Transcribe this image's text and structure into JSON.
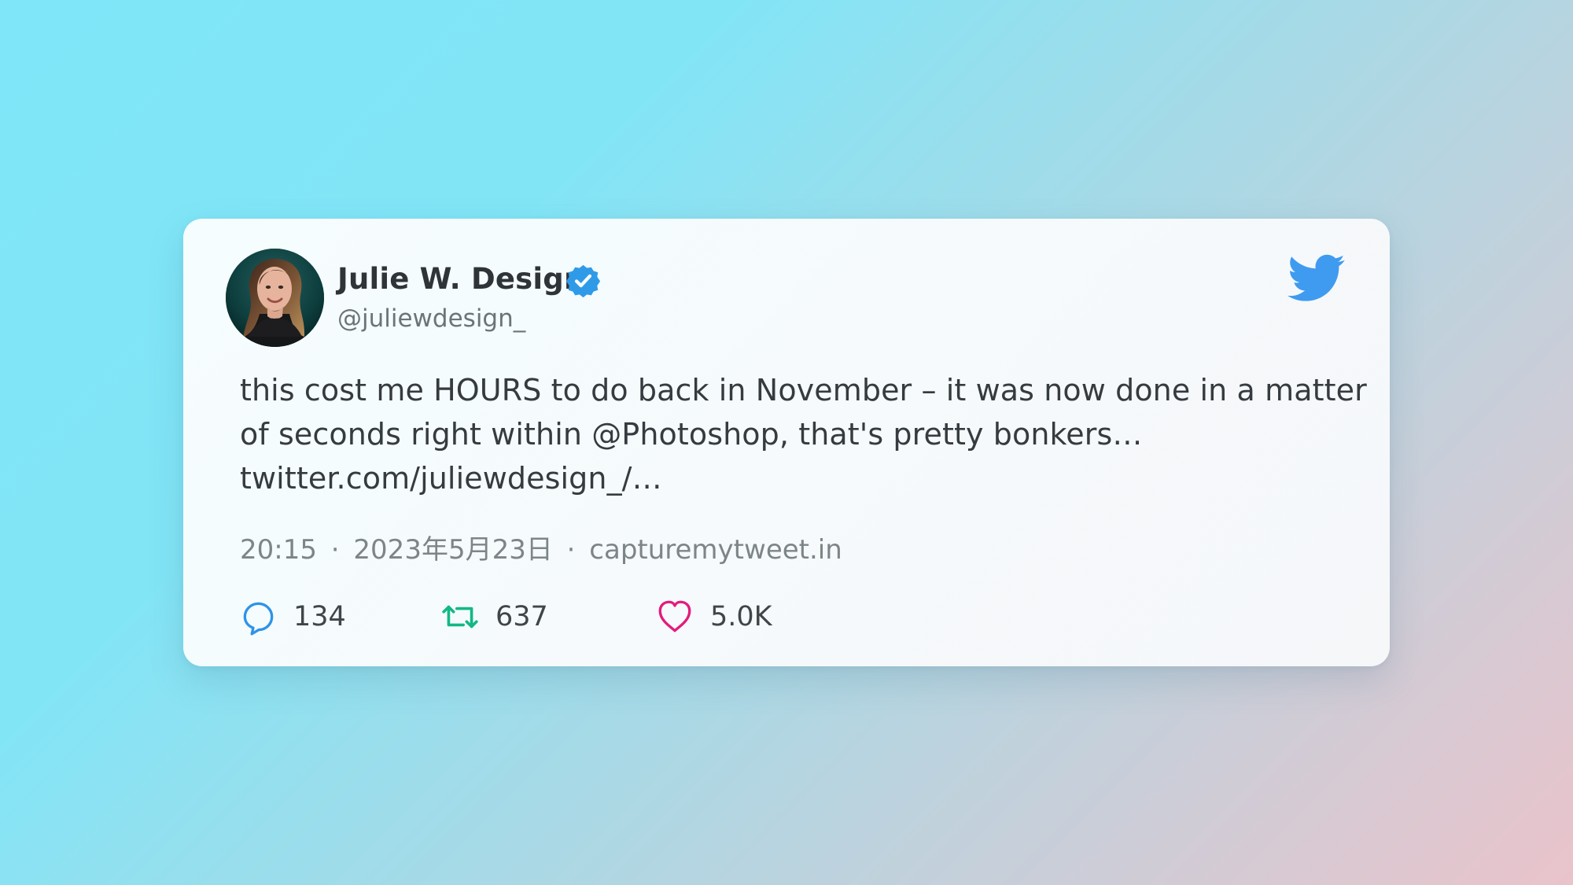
{
  "tweet": {
    "author_name": "Julie W. Design",
    "author_handle": "@juliewdesign_",
    "verified": true,
    "text_lines": [
      "this cost me HOURS to do back in November – it was now done in a matter",
      "of seconds right within @Photoshop, that's pretty bonkers…",
      "twitter.com/juliewdesign_/…"
    ],
    "time": "20:15",
    "date": "2023年5月23日",
    "source": "capturemytweet.in",
    "separator": "·"
  },
  "metrics": {
    "replies": "134",
    "retweets": "637",
    "likes": "5.0K"
  },
  "icons": {
    "brand": "twitter-bird-icon",
    "verified": "verified-badge-icon",
    "reply": "comment-bubble-icon",
    "retweet": "retweet-icon",
    "like": "heart-icon"
  },
  "colors": {
    "twitter_blue": "#1d9bf0",
    "verified_blue": "#2f9be8",
    "reply_blue": "#2f93e8",
    "retweet_green": "#12b885",
    "like_pink": "#e41b7d",
    "text": "#353b3f",
    "muted": "#7d8589"
  }
}
